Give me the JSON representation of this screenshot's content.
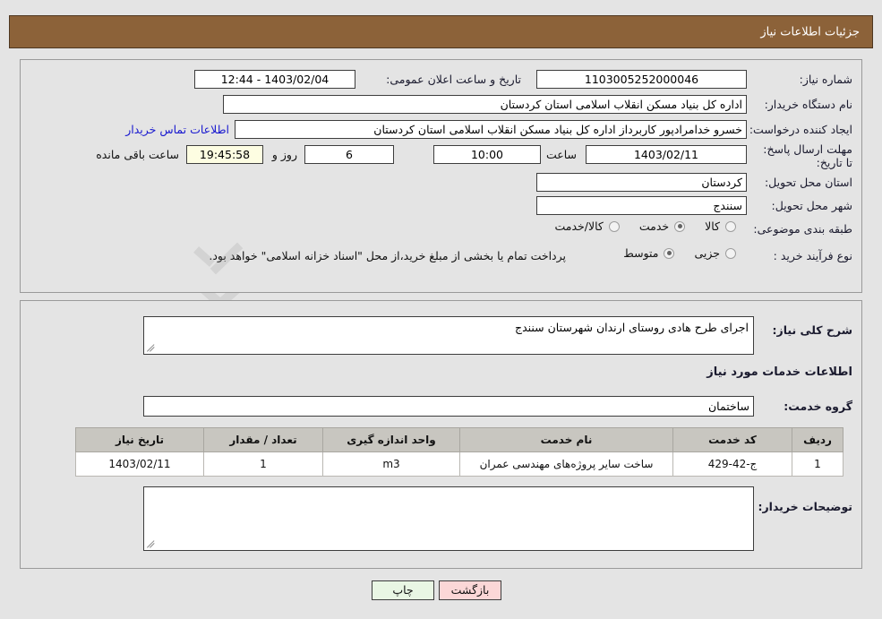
{
  "header": {
    "title": "جزئیات اطلاعات نیاز"
  },
  "top_form": {
    "need_number_label": "شماره نیاز:",
    "need_number_value": "1103005252000046",
    "public_announce_label": "تاریخ و ساعت اعلان عمومی:",
    "public_announce_value": "1403/02/04 - 12:44",
    "buyer_org_label": "نام دستگاه خریدار:",
    "buyer_org_value": "اداره کل بنیاد مسکن انقلاب اسلامی استان کردستان",
    "requester_label": "ایجاد کننده درخواست:",
    "requester_value": "خسرو خدامرادپور کاربرداز اداره کل بنیاد مسکن انقلاب اسلامی استان کردستان",
    "contact_link": "اطلاعات تماس خریدار",
    "deadline_label": "مهلت ارسال پاسخ: تا تاریخ:",
    "deadline_date": "1403/02/11",
    "hour_label": "ساعت",
    "deadline_time": "10:00",
    "days_value": "6",
    "days_label": "روز و",
    "countdown_value": "19:45:58",
    "countdown_label": "ساعت باقی مانده",
    "province_label": "استان محل تحویل:",
    "province_value": "کردستان",
    "city_label": "شهر محل تحویل:",
    "city_value": "سنندج",
    "category_label": "طبقه بندی موضوعی:",
    "category_options": [
      {
        "label": "کالا",
        "selected": false
      },
      {
        "label": "خدمت",
        "selected": true
      },
      {
        "label": "کالا/خدمت",
        "selected": false
      }
    ],
    "process_label": "نوع فرآیند خرید :",
    "process_options": [
      {
        "label": "جزیی",
        "selected": false
      },
      {
        "label": "متوسط",
        "selected": true
      }
    ],
    "payment_note": "پرداخت تمام یا بخشی از مبلغ خرید،از محل \"اسناد خزانه اسلامی\" خواهد بود."
  },
  "bottom_form": {
    "general_desc_label": "شرح کلی نیاز:",
    "general_desc_value": "اجرای طرح هادی روستای ارندان شهرستان سنندج",
    "services_section_title": "اطلاعات خدمات مورد نیاز",
    "service_group_label": "گروه خدمت:",
    "service_group_value": "ساختمان",
    "buyer_notes_label": "توضیحات خریدار:",
    "buyer_notes_value": ""
  },
  "table": {
    "columns": [
      "ردیف",
      "کد خدمت",
      "نام خدمت",
      "واحد اندازه گیری",
      "تعداد / مقدار",
      "تاریخ نیاز"
    ],
    "rows": [
      {
        "row": "1",
        "code": "ج-42-429",
        "name": "ساخت سایر پروژه‌های مهندسی عمران",
        "unit": "m3",
        "qty": "1",
        "date": "1403/02/11"
      }
    ]
  },
  "footer": {
    "print_label": "چاپ",
    "back_label": "بازگشت"
  },
  "watermark": {
    "text": "AnaTender.net"
  },
  "colors": {
    "header_bg": "#8c6239",
    "panel_bg": "#e4e4e4",
    "link": "#1818cf",
    "print_btn": "#e9f6e4",
    "back_btn": "#fbd7d7",
    "countdown_bg": "#fdfde2"
  }
}
